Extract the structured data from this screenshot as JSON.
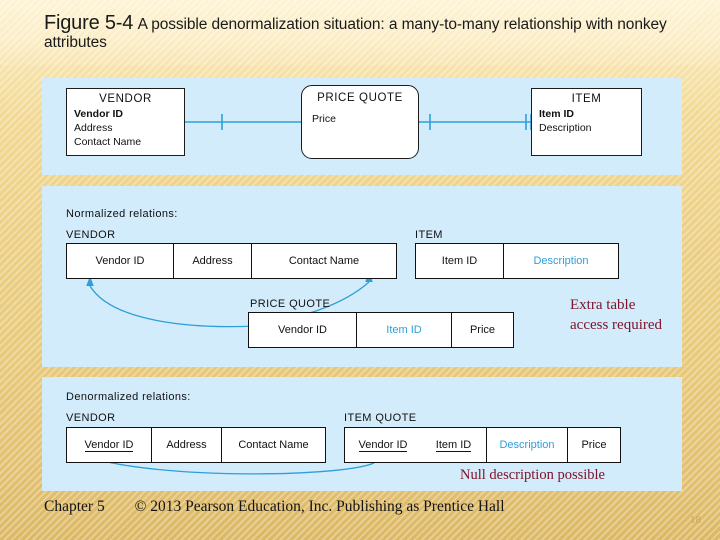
{
  "slide": {
    "title_figure": "Figure 5-4",
    "title_rest": "A possible denormalization situation: a many-to-many relationship with nonkey attributes",
    "page_number": "18",
    "footer": {
      "chapter": "Chapter 5",
      "copyright": "© 2013 Pearson Education, Inc.  Publishing as Prentice Hall"
    },
    "colors": {
      "panel_bg": "#d3ecfb",
      "slide_bg": "#eccf84",
      "annotation": "#7d1228",
      "blue_attribute": "#2e9fd8",
      "relationship_line": "#2e9fd8"
    }
  },
  "er_diagram": {
    "vendor": {
      "name": "VENDOR",
      "attributes": [
        "Vendor ID",
        "Address",
        "Contact Name"
      ]
    },
    "price_quote": {
      "name": "PRICE QUOTE",
      "attributes": [
        "Price"
      ]
    },
    "item": {
      "name": "ITEM",
      "attributes": [
        "Item ID",
        "Description"
      ]
    }
  },
  "normalized": {
    "caption": "Normalized relations:",
    "vendor": {
      "title": "VENDOR",
      "columns": [
        "Vendor ID",
        "Address",
        "Contact Name"
      ]
    },
    "item": {
      "title": "ITEM",
      "columns": [
        "Item ID",
        "Description"
      ]
    },
    "price_quote": {
      "title": "PRICE QUOTE",
      "columns": [
        "Vendor ID",
        "Item ID",
        "Price"
      ]
    },
    "annotation": "Extra table access required"
  },
  "denormalized": {
    "caption": "Denormalized relations:",
    "vendor": {
      "title": "VENDOR",
      "columns": [
        "Vendor ID",
        "Address",
        "Contact Name"
      ]
    },
    "item_quote": {
      "title": "ITEM QUOTE",
      "columns": [
        "Vendor ID",
        "Item ID",
        "Description",
        "Price"
      ]
    },
    "annotation": "Null description possible"
  }
}
